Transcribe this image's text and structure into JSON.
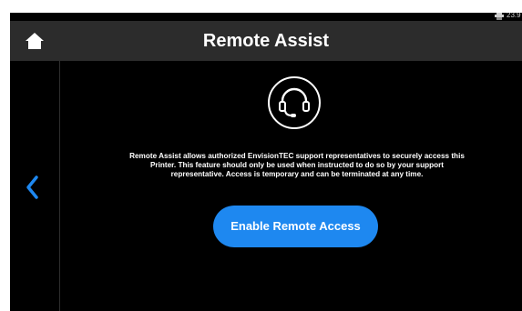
{
  "status_bar": {
    "icon": "printer-network-icon",
    "temperature": "23.9 °"
  },
  "header": {
    "home_icon": "home-icon",
    "title": "Remote Assist"
  },
  "navigation": {
    "back_icon": "chevron-left-icon"
  },
  "main": {
    "hero_icon": "headset-icon",
    "description": "Remote Assist allows authorized EnvisionTEC support representatives to securely access this Printer. This feature should only be used when instructed to do so by your support representative. Access is temporary and can be terminated at any time.",
    "enable_button_label": "Enable Remote Access"
  },
  "colors": {
    "background": "#000000",
    "header_background": "#2c2c2c",
    "accent": "#1e88f0",
    "text": "#ffffff"
  }
}
